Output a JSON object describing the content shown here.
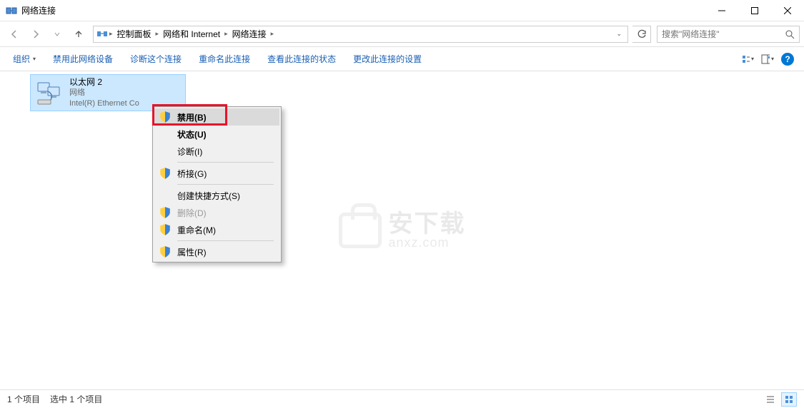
{
  "window": {
    "title": "网络连接"
  },
  "nav": {
    "breadcrumbs": [
      "控制面板",
      "网络和 Internet",
      "网络连接"
    ],
    "search_placeholder": "搜索\"网络连接\""
  },
  "cmd": {
    "organize": "组织",
    "items": [
      "禁用此网络设备",
      "诊断这个连接",
      "重命名此连接",
      "查看此连接的状态",
      "更改此连接的设置"
    ]
  },
  "adapter": {
    "name": "以太网 2",
    "status": "网络",
    "device": "Intel(R) Ethernet Co"
  },
  "context_menu": {
    "items": [
      {
        "label": "禁用(B)",
        "icon": "shield",
        "bold": true,
        "highlight": true
      },
      {
        "label": "状态(U)",
        "bold": true
      },
      {
        "label": "诊断(I)"
      },
      {
        "sep": true
      },
      {
        "label": "桥接(G)",
        "icon": "shield"
      },
      {
        "sep": true
      },
      {
        "label": "创建快捷方式(S)"
      },
      {
        "label": "删除(D)",
        "icon": "shield",
        "disabled": true
      },
      {
        "label": "重命名(M)",
        "icon": "shield"
      },
      {
        "sep": true
      },
      {
        "label": "属性(R)",
        "icon": "shield"
      }
    ]
  },
  "status": {
    "count": "1 个项目",
    "selected": "选中 1 个项目"
  },
  "watermark": {
    "line1": "安下载",
    "line2": "anxz.com"
  }
}
